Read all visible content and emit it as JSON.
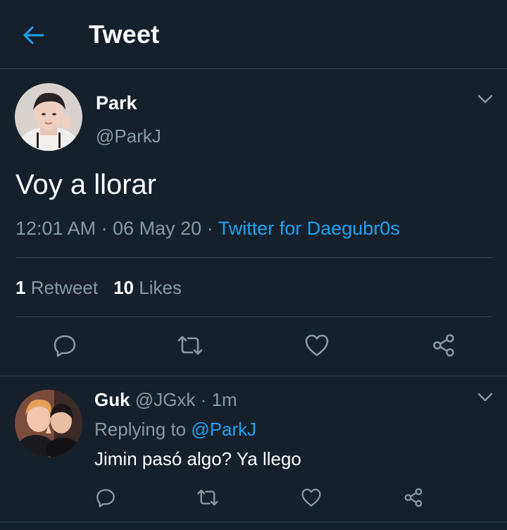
{
  "header": {
    "title": "Tweet",
    "back_icon": "arrow-left-icon"
  },
  "colors": {
    "background": "#15202b",
    "accent": "#1da1f2",
    "muted": "#8899a6",
    "divider": "#38444d"
  },
  "tweet": {
    "author_name": "Park",
    "author_handle": "@ParkJ",
    "text": "Voy a llorar",
    "time": "12:01 AM",
    "date": "06 May 20",
    "separator": "·",
    "source": "Twitter for Daegubr0s",
    "retweets_count": "1",
    "retweets_label": "Retweet",
    "likes_count": "10",
    "likes_label": "Likes",
    "actions": [
      "reply-icon",
      "retweet-icon",
      "like-icon",
      "share-icon"
    ]
  },
  "reply": {
    "author_name": "Guk",
    "author_handle": "@JGxk",
    "separator": "·",
    "age": "1m",
    "replying_label": "Replying to",
    "replying_to": "@ParkJ",
    "text": "Jimin pasó algo? Ya llego",
    "actions": [
      "reply-icon",
      "retweet-icon",
      "like-icon",
      "share-icon"
    ]
  }
}
